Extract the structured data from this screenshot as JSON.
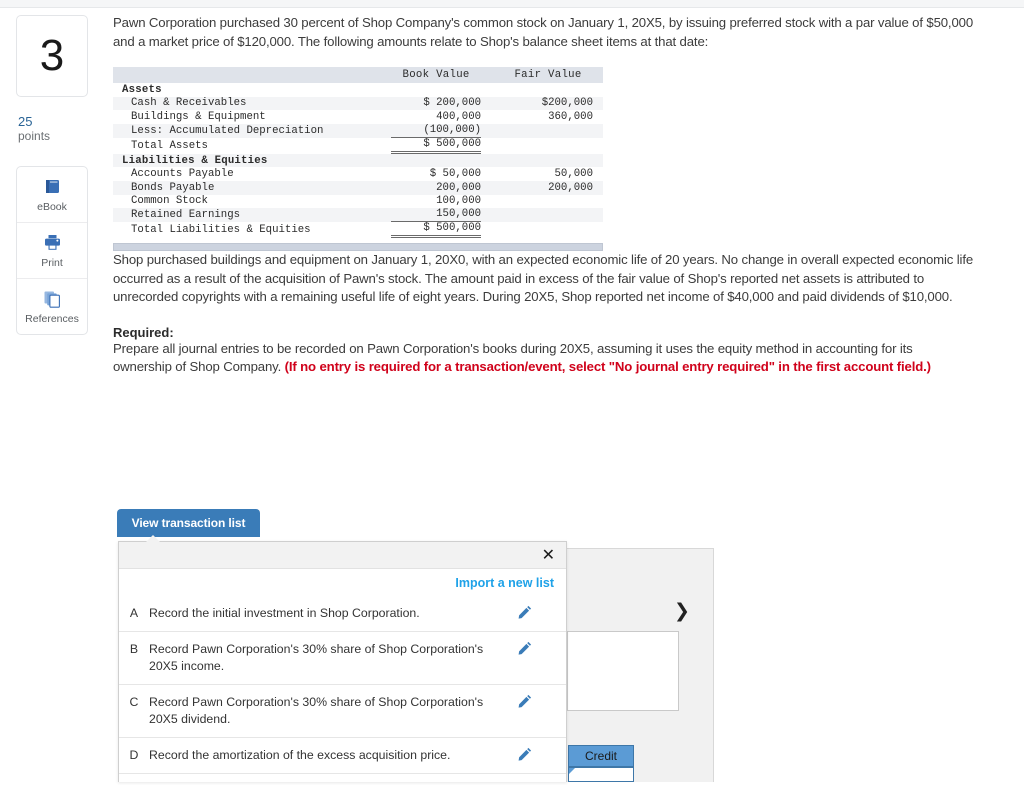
{
  "question": {
    "number": "3",
    "points_value": "25",
    "points_label": "points"
  },
  "tools": [
    {
      "name": "ebook",
      "label": "eBook",
      "icon": "book-icon"
    },
    {
      "name": "print",
      "label": "Print",
      "icon": "printer-icon"
    },
    {
      "name": "references",
      "label": "References",
      "icon": "copy-pages-icon"
    }
  ],
  "content": {
    "intro": "Pawn Corporation purchased 30 percent of Shop Company's common stock on January 1, 20X5, by issuing preferred stock with a par value of $50,000 and a market price of $120,000. The following amounts relate to Shop's balance sheet items at that date:",
    "middle": "Shop purchased buildings and equipment on January 1, 20X0, with an expected economic life of 20 years. No change in overall expected economic life occurred as a result of the acquisition of Pawn's stock. The amount paid in excess of the fair value of Shop's reported net assets is attributed to unrecorded copyrights with a remaining useful life of eight years. During 20X5, Shop reported net income of $40,000 and paid dividends of $10,000.",
    "required_title": "Required:",
    "required_text": "Prepare all journal entries to be recorded on Pawn Corporation's books during 20X5, assuming it uses the equity method in accounting for its ownership of Shop Company. ",
    "required_note": "(If no entry is required for a transaction/event, select \"No journal entry required\" in the first account field.)"
  },
  "balance_sheet": {
    "headers": {
      "label": "",
      "book_value": "Book Value",
      "fair_value": "Fair Value"
    },
    "rows": [
      {
        "type": "section",
        "label": "Assets",
        "book_value": "",
        "fair_value": ""
      },
      {
        "type": "item",
        "label": "Cash & Receivables",
        "book_value": "$ 200,000",
        "fair_value": "$200,000"
      },
      {
        "type": "item",
        "label": "Buildings & Equipment",
        "book_value": "400,000",
        "fair_value": "360,000"
      },
      {
        "type": "item",
        "label": "Less: Accumulated Depreciation",
        "book_value": "(100,000)",
        "fair_value": "",
        "rule": "single"
      },
      {
        "type": "total",
        "label": "Total Assets",
        "book_value": "$ 500,000",
        "fair_value": "",
        "rule": "double"
      },
      {
        "type": "section",
        "label": "Liabilities & Equities",
        "book_value": "",
        "fair_value": ""
      },
      {
        "type": "item",
        "label": "Accounts Payable",
        "book_value": "$  50,000",
        "fair_value": "50,000"
      },
      {
        "type": "item",
        "label": "Bonds Payable",
        "book_value": "200,000",
        "fair_value": "200,000"
      },
      {
        "type": "item",
        "label": "Common Stock",
        "book_value": "100,000",
        "fair_value": ""
      },
      {
        "type": "item",
        "label": "Retained Earnings",
        "book_value": "150,000",
        "fair_value": "",
        "rule": "single"
      },
      {
        "type": "total",
        "label": "Total Liabilities & Equities",
        "book_value": "$ 500,000",
        "fair_value": "",
        "rule": "double"
      }
    ]
  },
  "toolbar": {
    "view_transaction_list": "View transaction list"
  },
  "popup": {
    "close_label": "✕",
    "import_link": "Import a new list",
    "transactions": [
      {
        "letter": "A",
        "text": "Record the initial investment in Shop Corporation."
      },
      {
        "letter": "B",
        "text": "Record Pawn Corporation's 30% share of Shop Corporation's 20X5 income."
      },
      {
        "letter": "C",
        "text": "Record Pawn Corporation's 30% share of Shop Corporation's 20X5 dividend."
      },
      {
        "letter": "D",
        "text": "Record the amortization of the excess acquisition price."
      }
    ]
  },
  "journal_grid": {
    "credit_header": "Credit",
    "next_chevron": "❯"
  },
  "colors": {
    "accent_blue": "#3a7cb8",
    "link_blue": "#1fa2e8",
    "alert_red": "#d0021b",
    "table_header_bg": "#dfe3ea",
    "grid_header_blue": "#5b9bd5"
  }
}
